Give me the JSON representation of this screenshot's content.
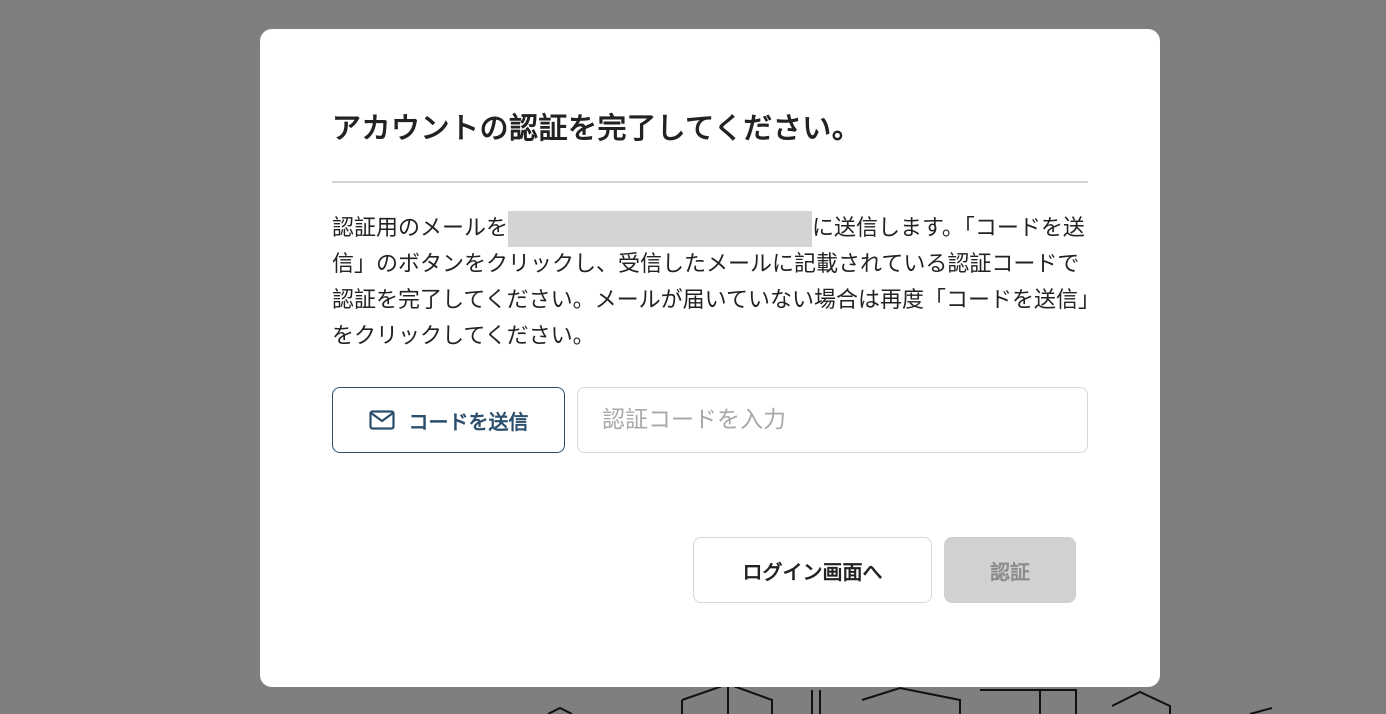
{
  "modal": {
    "title": "アカウントの認証を完了してください。",
    "description_before": "認証用のメールを",
    "description_after": "に送信します。「コードを送信」のボタンをクリックし、受信したメールに記載されている認証コードで認証を完了してください。メールが届いていない場合は再度「コードを送信」をクリックしてください。",
    "send_code_button": {
      "label": "コードを送信",
      "icon": "mail-icon"
    },
    "code_input": {
      "placeholder": "認証コードを入力",
      "value": ""
    },
    "back_to_login_button": "ログイン画面へ",
    "verify_button": "認証"
  },
  "colors": {
    "backdrop": "#7f7f7f",
    "primary": "#2a4e6c",
    "disabled_bg": "#d1d0d3"
  }
}
